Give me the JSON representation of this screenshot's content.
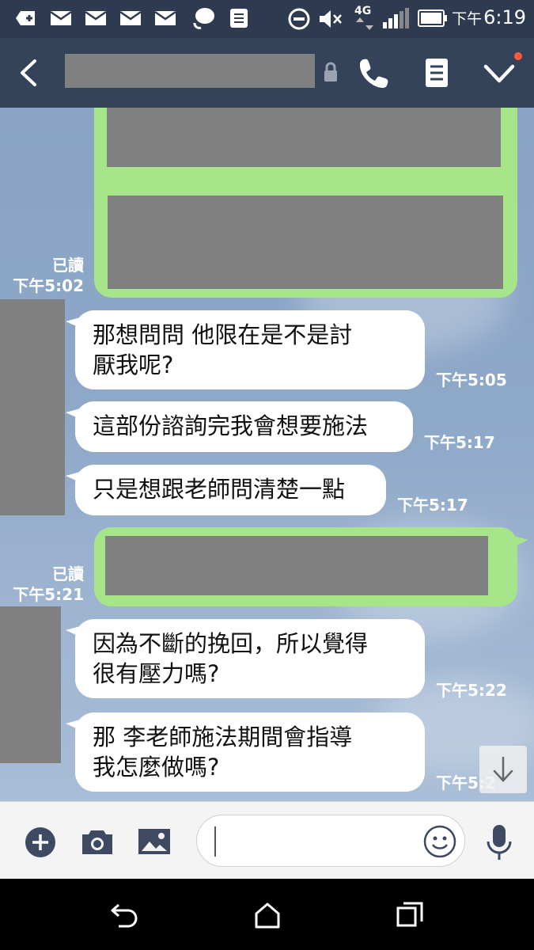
{
  "status_bar": {
    "network": "4G",
    "time_prefix": "下午",
    "time": "6:19"
  },
  "header": {
    "contact_name": "",
    "icons": [
      "back-arrow-icon",
      "lock-icon",
      "phone-icon",
      "notes-icon",
      "chevron-down-icon"
    ]
  },
  "messages": [
    {
      "side": "out",
      "read_label": "已讀",
      "time": "下午5:02"
    },
    {
      "side": "in",
      "text_line1": "那想問問  他限在是不是討",
      "text_line2": "厭我呢?",
      "time": "下午5:05"
    },
    {
      "side": "in",
      "text": "這部份諮詢完我會想要施法",
      "time": "下午5:17"
    },
    {
      "side": "in",
      "text": "只是想跟老師問清楚一點",
      "time": "下午5:17"
    },
    {
      "side": "out",
      "read_label": "已讀",
      "time": "下午5:21"
    },
    {
      "side": "in",
      "text_line1": "因為不斷的挽回，所以覺得",
      "text_line2": "很有壓力嗎?",
      "time": "下午5:22"
    },
    {
      "side": "in",
      "text_line1": "那  李老師施法期間會指導",
      "text_line2": "我怎麼做嗎?",
      "time": "下午5:2"
    }
  ],
  "input_bar": {
    "message_value": "",
    "icons": [
      "plus-icon",
      "camera-icon",
      "image-icon",
      "emoji-icon",
      "microphone-icon"
    ]
  },
  "colors": {
    "header_bg": "#34425a",
    "status_bg": "#2e3a4f",
    "outgoing_bubble": "#a7e58b",
    "incoming_bubble": "#ffffff",
    "redaction": "#808080",
    "notification_dot": "#ff5a3c"
  }
}
